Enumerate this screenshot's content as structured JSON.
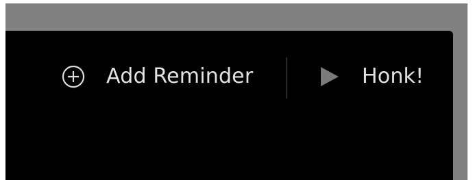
{
  "toolbar": {
    "add_reminder": {
      "label": "Add Reminder",
      "icon": "plus-circle-icon"
    },
    "honk": {
      "label": "Honk!",
      "icon": "play-icon"
    }
  },
  "colors": {
    "panel_background": "#010101",
    "surround": "#808080",
    "text": "#e3e3e3",
    "play_icon": "#7a7a7a"
  }
}
